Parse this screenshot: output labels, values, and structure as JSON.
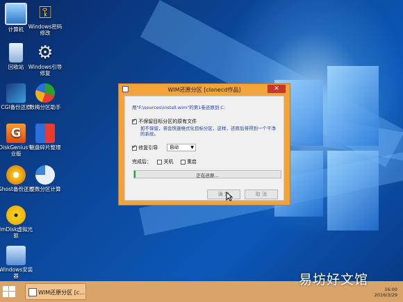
{
  "desktop_icons": [
    {
      "label": "计算机",
      "icon": "computer-icon"
    },
    {
      "label": "Windows密码修改",
      "icon": "key-icon"
    },
    {
      "label": "回收站",
      "icon": "recycle-bin-icon"
    },
    {
      "label": "Windows引导修复",
      "icon": "gear-icon"
    },
    {
      "label": "CGI备份还原",
      "icon": "cgi-tool-icon"
    },
    {
      "label": "数梅分区助手",
      "icon": "partition-assistant-icon"
    },
    {
      "label": "DiskGenius专业版",
      "icon": "diskgenius-icon"
    },
    {
      "label": "磁盘碎片整理",
      "icon": "defrag-icon"
    },
    {
      "label": "Ghost备份还原",
      "icon": "ghost-icon"
    },
    {
      "label": "整数分区计算",
      "icon": "pie-chart-icon"
    },
    {
      "label": "ImDisk虚拟光驱",
      "icon": "disc-icon"
    },
    {
      "label": "Windows安装器",
      "icon": "installer-icon"
    }
  ],
  "dialog": {
    "title": "WIM还原分区  [clonecd作品]",
    "close_label": "✕",
    "source_line": "用\"F:\\sources\\install.wim\"的第1卷还原到 C:",
    "keep_files_label": "不保留目标分区的原有文件",
    "keep_files_checked": true,
    "keep_files_desc": "如不保留，将会快速格式化目标分区，这样，还原后将得到一个干净的系统。",
    "repair_boot_label": "修复引导",
    "repair_boot_checked": true,
    "boot_mode_value": "自动",
    "after_label": "完成后：",
    "shutdown_label": "关机",
    "restart_label": "重启",
    "progress_text": "正在还原...",
    "progress_fraction": 0.01,
    "ok_label": "确 定",
    "cancel_label": "取 消"
  },
  "taskbar": {
    "task_label": "WIM还原分区  [c...",
    "time": "16:00",
    "date": "2016/3/29"
  },
  "watermark": "易坊好文馆",
  "colors": {
    "dialog_frame": "#f2a33a",
    "taskbar": "#d9a46a",
    "progress_fill": "#06b025",
    "close_button": "#c7382b"
  }
}
